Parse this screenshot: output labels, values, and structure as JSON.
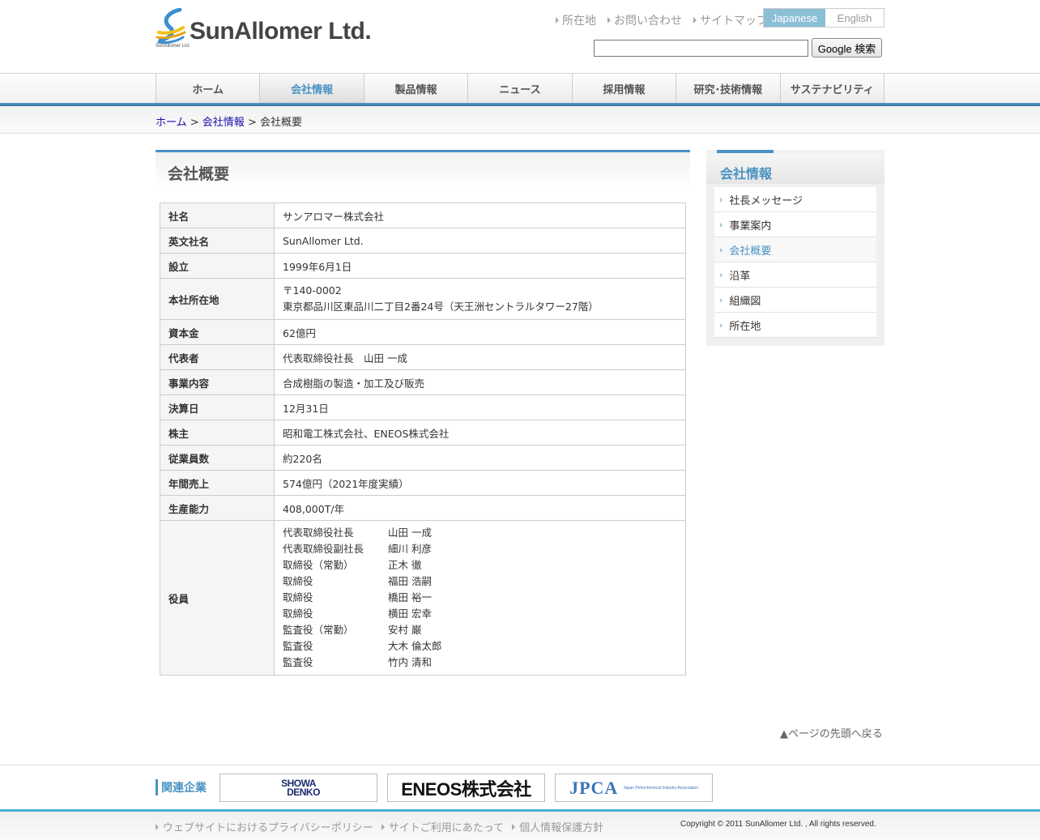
{
  "header": {
    "logo_text": "SunAllomer Ltd.",
    "logo_sub": "SunAllomer Ltd.",
    "top_links": [
      "所在地",
      "お問い合わせ",
      "サイトマップ"
    ],
    "lang_japanese": "Japanese",
    "lang_english": "English",
    "search_value": "",
    "search_button": "Google 検索"
  },
  "nav": [
    "ホーム",
    "会社情報",
    "製品情報",
    "ニュース",
    "採用情報",
    "研究･技術情報",
    "サステナビリティ"
  ],
  "nav_active_index": 1,
  "breadcrumb": {
    "home": "ホーム",
    "sep1": " > ",
    "parent": "会社情報",
    "sep2": " > ",
    "current": "会社概要"
  },
  "main": {
    "title": "会社概要",
    "rows": [
      {
        "label": "社名",
        "value": "サンアロマー株式会社"
      },
      {
        "label": "英文社名",
        "value": "SunAllomer Ltd."
      },
      {
        "label": "設立",
        "value": "1999年6月1日"
      },
      {
        "label": "本社所在地",
        "value_lines": [
          "〒140-0002",
          "東京都品川区東品川二丁目2番24号（天王洲セントラルタワー27階）"
        ]
      },
      {
        "label": "資本金",
        "value": "62億円"
      },
      {
        "label": "代表者",
        "value": "代表取締役社長　山田 一成"
      },
      {
        "label": "事業内容",
        "value": "合成樹脂の製造・加工及び販売"
      },
      {
        "label": "決算日",
        "value": "12月31日"
      },
      {
        "label": "株主",
        "value": "昭和電工株式会社、ENEOS株式会社"
      },
      {
        "label": "従業員数",
        "value": "約220名"
      },
      {
        "label": "年間売上",
        "value": "574億円（2021年度実績）"
      },
      {
        "label": "生産能力",
        "value": "408,000T/年"
      }
    ],
    "officers_label": "役員",
    "officers": [
      {
        "role": "代表取締役社長",
        "name": "山田 一成"
      },
      {
        "role": "代表取締役副社長",
        "name": "細川 利彦"
      },
      {
        "role": "取締役（常勤）",
        "name": "正木 徹"
      },
      {
        "role": "取締役",
        "name": "福田 浩嗣"
      },
      {
        "role": "取締役",
        "name": "橋田 裕一"
      },
      {
        "role": "取締役",
        "name": "横田 宏幸"
      },
      {
        "role": "監査役（常勤）",
        "name": "安村 巌"
      },
      {
        "role": "監査役",
        "name": "大木 倫太郎"
      },
      {
        "role": "監査役",
        "name": "竹内 清和"
      }
    ]
  },
  "sidebar": {
    "title": "会社情報",
    "items": [
      "社長メッセージ",
      "事業案内",
      "会社概要",
      "沿革",
      "組織図",
      "所在地"
    ],
    "active_index": 2
  },
  "page_top": "▲ページの先頭へ戻る",
  "footer": {
    "related_label": "関連企業",
    "banners": {
      "showa_line1": "SHOWA",
      "showa_line2": "DENKO",
      "eneos": "ENEOS株式会社",
      "jpca": "JPCA",
      "jpca_sub": "Japan Petrochemical Industry Association"
    },
    "links": [
      "ウェブサイトにおけるプライバシーポリシー",
      "サイトご利用にあたって",
      "個人情報保護方針"
    ],
    "copyright": "Copyright © 2011 SunAllomer Ltd. , All rights reserved."
  },
  "colors": {
    "accent": "#4a93c2",
    "nav_bottom_line": "#2a6f9d",
    "footer_line": "#4ab0d4",
    "lang_active_bg": "#8bbfd6"
  }
}
